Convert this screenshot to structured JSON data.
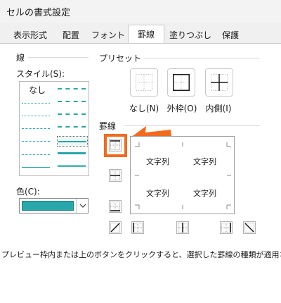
{
  "window": {
    "title": "セルの書式設定"
  },
  "tabs": [
    {
      "label": "表示形式",
      "active": false
    },
    {
      "label": "配置",
      "active": false
    },
    {
      "label": "フォント",
      "active": false
    },
    {
      "label": "罫線",
      "active": true
    },
    {
      "label": "塗りつぶし",
      "active": false
    },
    {
      "label": "保護",
      "active": false
    }
  ],
  "line_group": {
    "title": "線",
    "style_label": "スタイル(S):",
    "none_label": "なし",
    "color_label": "色(C):",
    "color_value": "#29a8ac"
  },
  "preset_group": {
    "title": "プリセット",
    "buttons": [
      {
        "label": "なし(N)",
        "icon": "preset-none-icon"
      },
      {
        "label": "外枠(O)",
        "icon": "preset-outline-icon"
      },
      {
        "label": "内側(I)",
        "icon": "preset-inside-icon"
      }
    ]
  },
  "border_group": {
    "title": "罫線",
    "preview_texts": [
      "文字列",
      "文字列",
      "文字列",
      "文字列"
    ],
    "highlighted_button": "border-top"
  },
  "footer_text": "プレビュー枠内または上のボタンをクリックすると、選択した罫線の種類が適用されます。",
  "colors": {
    "highlight": "#f26b1d",
    "selected_color": "#29a8ac"
  }
}
